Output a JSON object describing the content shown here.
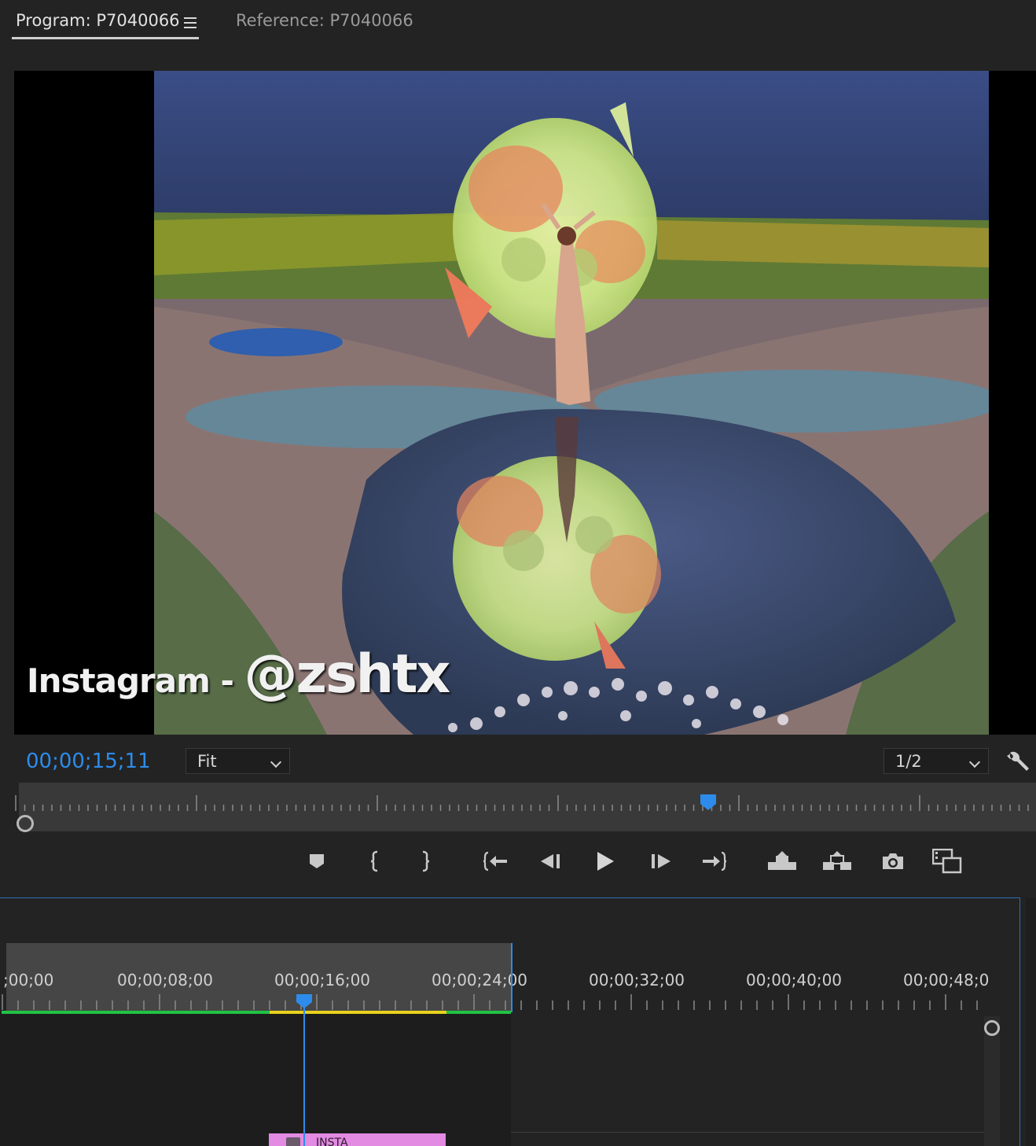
{
  "panel": {
    "active_tab": "Program: P7040066",
    "inactive_tab": "Reference: P7040066"
  },
  "monitor": {
    "watermark_part1": "Instagram - ",
    "watermark_part2": "@zshtx"
  },
  "controls": {
    "timecode": "00;00;15;11",
    "zoom_value": "Fit",
    "resolution_value": "1/2"
  },
  "transport": {
    "buttons": [
      "add-marker",
      "mark-in",
      "mark-out",
      "go-to-in",
      "step-back",
      "play",
      "step-forward",
      "go-to-out",
      "lift",
      "extract",
      "export-frame",
      "comparison-view"
    ]
  },
  "timeline": {
    "ruler_labels": [
      ";00;00",
      "00;00;08;00",
      "00;00;16;00",
      "00;00;24;00",
      "00;00;32;00",
      "00;00;40;00",
      "00;00;48;0"
    ],
    "clip_label": "INSTA"
  },
  "colors": {
    "accent": "#2d8ceb",
    "render_green": "#22c244",
    "render_yellow": "#e8d21c",
    "clip_pink": "#e38ae3"
  }
}
